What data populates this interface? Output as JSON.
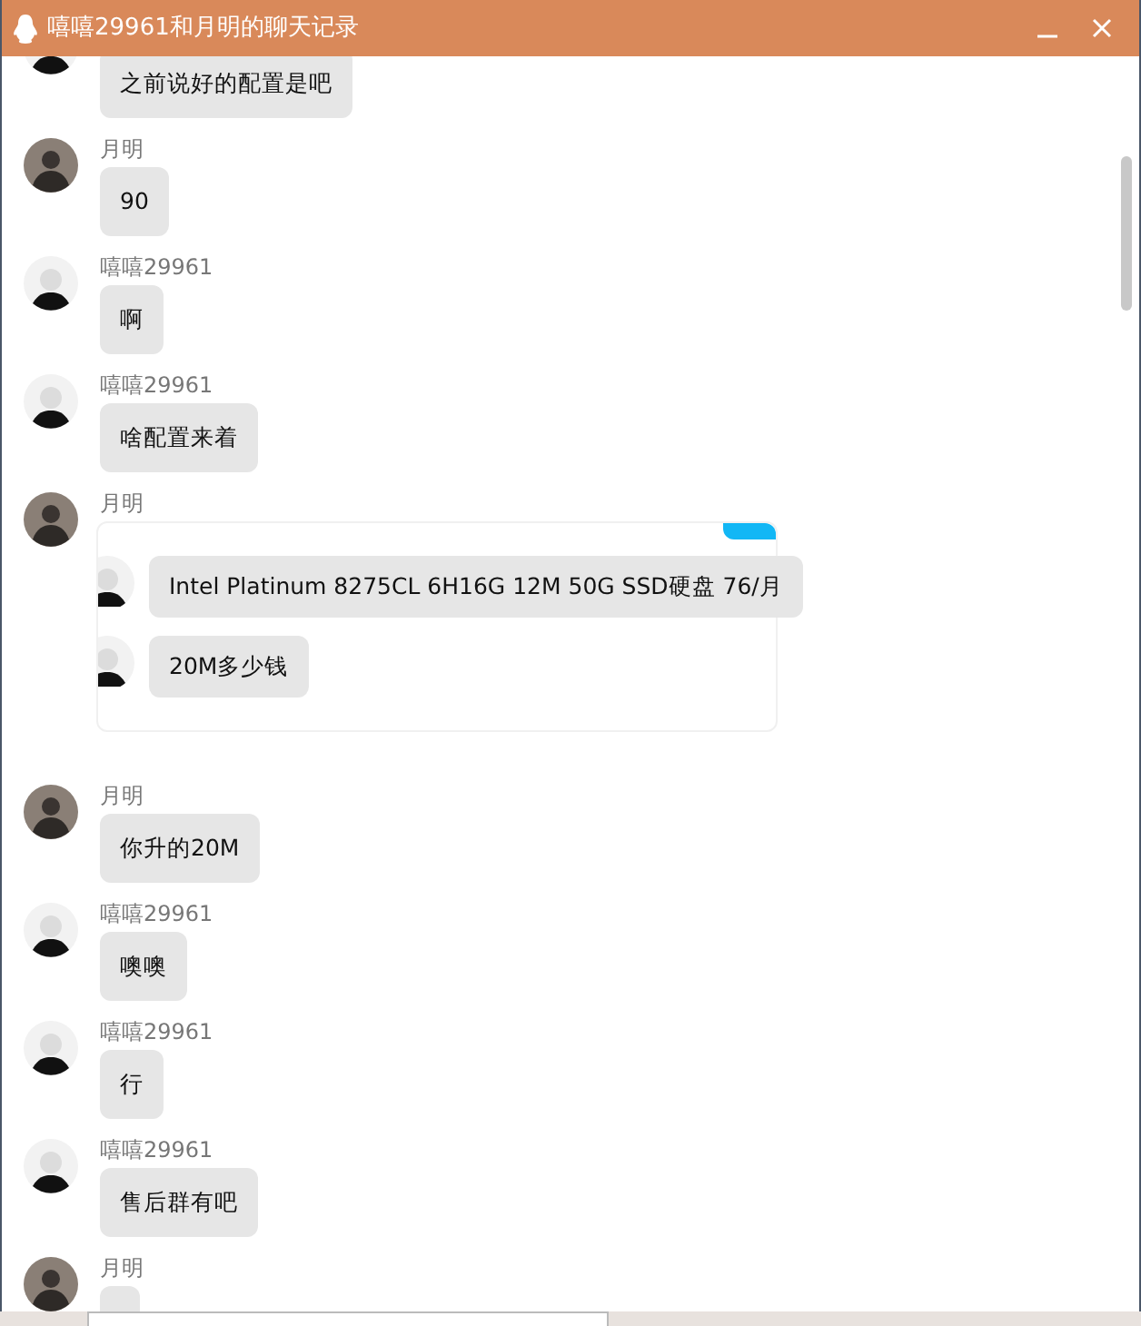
{
  "window": {
    "title": "嘻嘻29961和月明的聊天记录",
    "buttons": [
      {
        "kind": "minimize"
      },
      {
        "kind": "close"
      }
    ]
  },
  "messages": [
    {
      "kind": "text",
      "avatar": {
        "kind": "cartoon"
      },
      "text": "之前说好的配置是吧"
    },
    {
      "kind": "text",
      "avatar": {
        "kind": "photo"
      },
      "sender": "月明",
      "text": "90"
    },
    {
      "kind": "text",
      "avatar": {
        "kind": "cartoon"
      },
      "sender": "嘻嘻29961",
      "text": "啊"
    },
    {
      "kind": "text",
      "avatar": {
        "kind": "cartoon"
      },
      "sender": "嘻嘻29961",
      "text": "啥配置来着"
    },
    {
      "kind": "forward",
      "avatar": {
        "kind": "photo"
      },
      "sender": "月明",
      "items": [
        {
          "avatar": {
            "kind": "cartoon"
          },
          "text": "Intel Platinum 8275CL 6H16G 12M 50G SSD硬盘 76/月"
        },
        {
          "avatar": {
            "kind": "cartoon"
          },
          "text": "20M多少钱"
        }
      ]
    },
    {
      "kind": "text",
      "avatar": {
        "kind": "photo"
      },
      "sender": "月明",
      "text": "你升的20M"
    },
    {
      "kind": "text",
      "avatar": {
        "kind": "cartoon"
      },
      "sender": "嘻嘻29961",
      "text": "噢噢"
    },
    {
      "kind": "text",
      "avatar": {
        "kind": "cartoon"
      },
      "sender": "嘻嘻29961",
      "text": "行"
    },
    {
      "kind": "text",
      "avatar": {
        "kind": "cartoon"
      },
      "sender": "嘻嘻29961",
      "text": "售后群有吧"
    },
    {
      "kind": "text",
      "avatar": {
        "kind": "photo"
      },
      "sender": "月明"
    }
  ]
}
